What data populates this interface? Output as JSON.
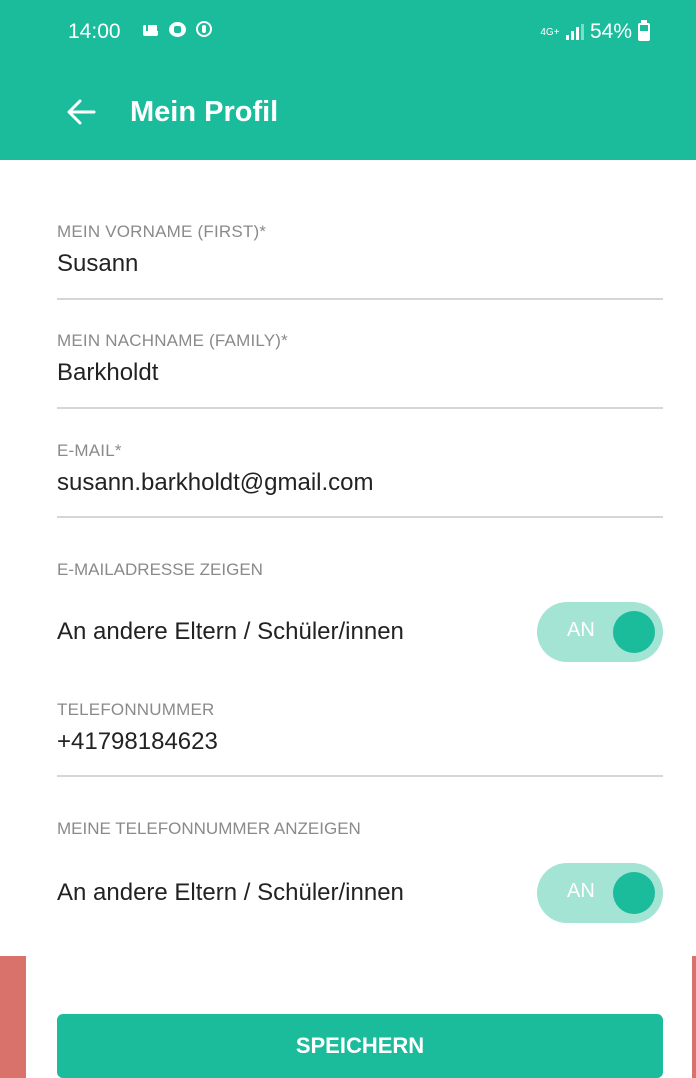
{
  "status_bar": {
    "time": "14:00",
    "network": "4G+",
    "battery": "54%",
    "icons": [
      "mail-icon",
      "chat-icon",
      "pinterest-icon"
    ]
  },
  "app_bar": {
    "title": "Mein Profil",
    "back_icon": "arrow-left-icon"
  },
  "form": {
    "first_name": {
      "label": "MEIN VORNAME (FIRST)*",
      "value": "Susann"
    },
    "last_name": {
      "label": "MEIN NACHNAME (FAMILY)*",
      "value": "Barkholdt"
    },
    "email": {
      "label": "E-MAIL*",
      "value": "susann.barkholdt@gmail.com"
    },
    "show_email": {
      "label": "E-MAILADRESSE ZEIGEN",
      "option_label": "An andere Eltern / Schüler/innen",
      "toggle_text": "AN"
    },
    "phone": {
      "label": "TELEFONNUMMER",
      "value": "+41798184623"
    },
    "show_phone": {
      "label": "MEINE TELEFONNUMMER ANZEIGEN",
      "option_label": "An andere Eltern / Schüler/innen",
      "toggle_text": "AN"
    }
  },
  "save_button": {
    "label": "SPEICHERN"
  },
  "colors": {
    "accent": "#1abc9c",
    "toggle_track": "#a3e4d4",
    "background_edge": "#d8726a"
  }
}
